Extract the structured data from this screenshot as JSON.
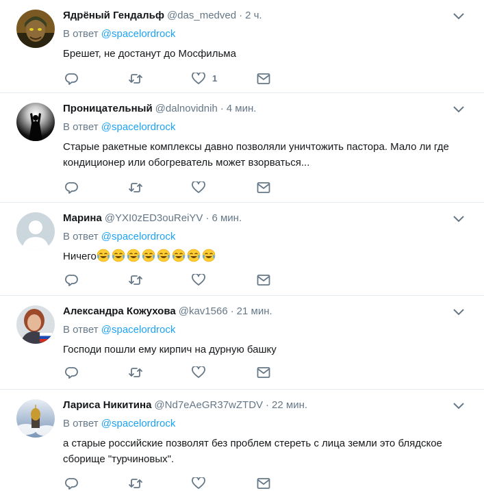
{
  "tweets": [
    {
      "name": "Ядрёный Гендальф",
      "handle": "@das_medved",
      "time": "2 ч.",
      "reply_prefix": "В ответ",
      "reply_to": "@spacelordrock",
      "text": "Брешет, не достанут до Мосфильма",
      "likes": "1",
      "avatar_icon": "warrior-avatar"
    },
    {
      "name": "Проницательный",
      "handle": "@dalnovidnih",
      "time": "4 мин.",
      "reply_prefix": "В ответ",
      "reply_to": "@spacelordrock",
      "text": "Старые ракетные комплексы давно позволяли уничтожить пастора. Мало ли где кондиционер или обогреватель может взорваться...",
      "likes": "",
      "avatar_icon": "concert-silhouette-avatar"
    },
    {
      "name": "Марина",
      "handle": "@YXI0zED3ouReiYV",
      "time": "6 мин.",
      "reply_prefix": "В ответ",
      "reply_to": "@spacelordrock",
      "text": "Ничего",
      "emoji_count": 8,
      "emoji_icon": "face-with-tears-of-joy-emoji",
      "likes": "",
      "avatar_icon": "default-profile-avatar"
    },
    {
      "name": "Александра Кожухова",
      "handle": "@kav1566",
      "time": "21 мин.",
      "reply_prefix": "В ответ",
      "reply_to": "@spacelordrock",
      "text": "Господи пошли ему кирпич на дурную башку",
      "likes": "",
      "avatar_icon": "woman-with-russian-flag-avatar"
    },
    {
      "name": "Лариса Никитина",
      "handle": "@Nd7eAeGR37wZTDV",
      "time": "22 мин.",
      "reply_prefix": "В ответ",
      "reply_to": "@spacelordrock",
      "text": "а старые российские позволят без проблем стереть с лица земли это блядское сборище \"турчиновых\".",
      "likes": "",
      "avatar_icon": "church-in-clouds-avatar"
    }
  ],
  "colors": {
    "link": "#1da1f2",
    "secondary": "#657786",
    "icon": "#657786",
    "divider": "#e6ecf0"
  }
}
